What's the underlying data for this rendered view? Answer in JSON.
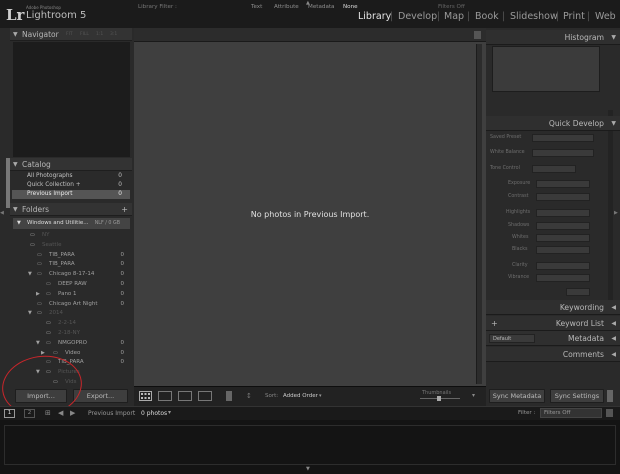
{
  "app": {
    "logo": "Lr",
    "vendor": "Adobe Photoshop",
    "product": "Lightroom 5"
  },
  "modules": [
    "Library",
    "Develop",
    "Map",
    "Book",
    "Slideshow",
    "Print",
    "Web"
  ],
  "active_module": "Library",
  "left_panel": {
    "navigator": {
      "title": "Navigator",
      "zoom": [
        "FIT",
        "FILL",
        "1:1",
        "3:1"
      ]
    },
    "catalog": {
      "title": "Catalog",
      "items": [
        {
          "label": "All Photographs",
          "count": "0"
        },
        {
          "label": "Quick Collection +",
          "count": "0"
        },
        {
          "label": "Previous Import",
          "count": "0"
        }
      ]
    },
    "folders": {
      "title": "Folders",
      "volume": "Windows and Utilitie...",
      "volume_size": "NLF / 0 GB",
      "rows": [
        {
          "label": "NY",
          "count": ""
        },
        {
          "label": "Seattle",
          "count": ""
        },
        {
          "label": "TIB_PARA",
          "count": "0"
        },
        {
          "label": "TIB_PARA",
          "count": "0"
        },
        {
          "label": "Chicago 8-17-14",
          "count": "0"
        },
        {
          "label": "DEEP RAW",
          "count": "0"
        },
        {
          "label": "Pano 1",
          "count": "0"
        },
        {
          "label": "Chicago Art Night",
          "count": "0"
        },
        {
          "label": "2014",
          "count": ""
        },
        {
          "label": "2-2-14",
          "count": ""
        },
        {
          "label": "2-18-NY",
          "count": ""
        },
        {
          "label": "NMGOPRO",
          "count": "0"
        },
        {
          "label": "Video",
          "count": "0"
        },
        {
          "label": "TIB_PARA",
          "count": "0"
        },
        {
          "label": "Pictures",
          "count": ""
        },
        {
          "label": "Vids",
          "count": ""
        }
      ]
    },
    "import_button": "Import...",
    "export_button": "Export..."
  },
  "filter_bar": {
    "title": "Library Filter :",
    "tabs": [
      "Text",
      "Attribute",
      "Metadata",
      "None"
    ],
    "active": "None",
    "filters": "Filters Off"
  },
  "center": {
    "empty_message": "No photos in Previous Import."
  },
  "toolbar": {
    "sort_label": "Sort:",
    "sort_value": "Added Order",
    "thumbnails": "Thumbnails"
  },
  "right_panel": {
    "histogram": "Histogram",
    "quick_develop": "Quick Develop",
    "qd_rows": [
      "Saved Preset",
      "White Balance",
      "Tone Control",
      "Exposure",
      "Contrast",
      "Highlights",
      "Shadows",
      "Whites",
      "Blacks",
      "Clarity",
      "Vibrance"
    ],
    "keywording": "Keywording",
    "keyword_list": "Keyword List",
    "metadata": "Metadata",
    "metadata_default": "Default",
    "comments": "Comments",
    "sync_metadata": "Sync Metadata",
    "sync_settings": "Sync Settings"
  },
  "filmstrip": {
    "page1": "1",
    "page2": "2",
    "source": "Previous Import",
    "photo_count": "0 photos",
    "filter_label": "Filter :",
    "filter_value": "Filters Off"
  }
}
